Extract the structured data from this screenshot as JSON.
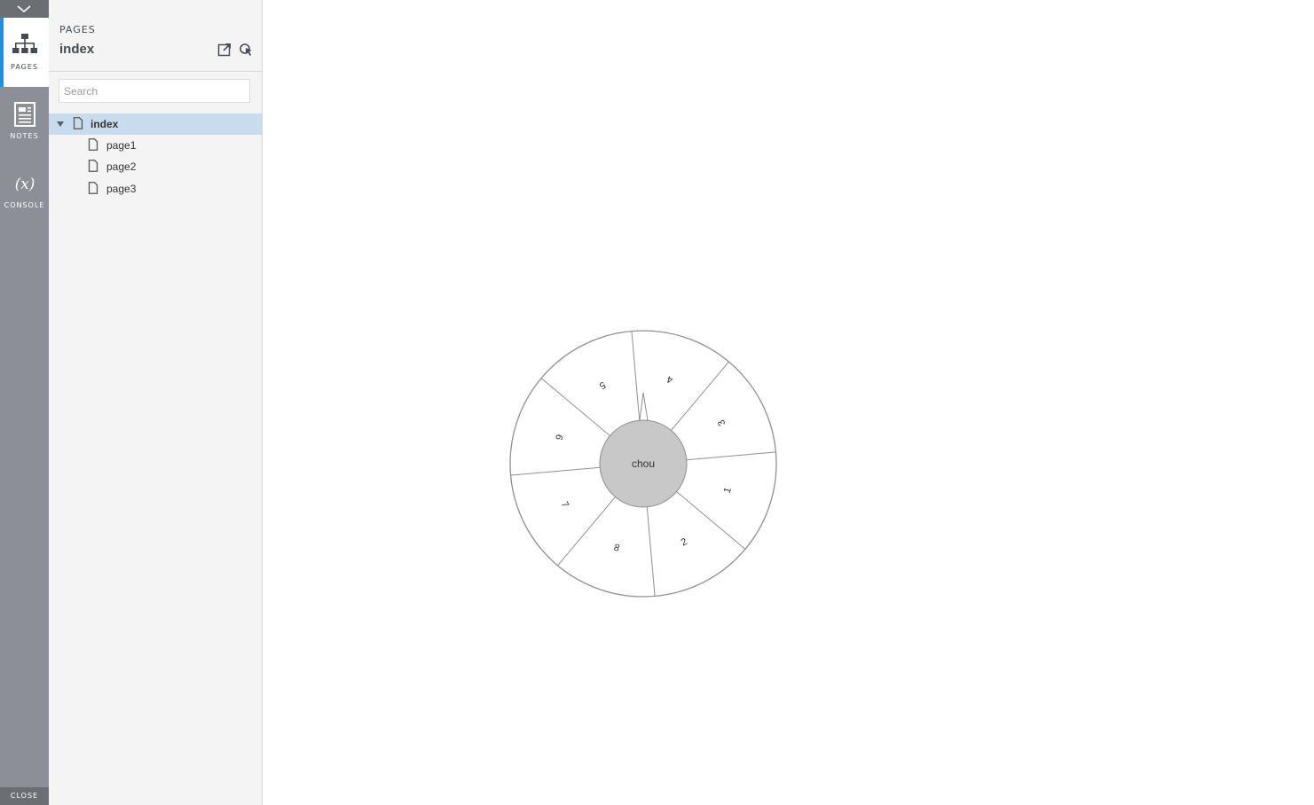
{
  "rail": {
    "tabs": [
      {
        "label": "PAGES",
        "icon": "sitemap-icon",
        "active": true
      },
      {
        "label": "NOTES",
        "icon": "notes-icon",
        "active": false
      },
      {
        "label": "CONSOLE",
        "icon": "variable-icon",
        "active": false
      }
    ],
    "close_label": "CLOSE"
  },
  "panel": {
    "heading": "PAGES",
    "current_page": "index",
    "search_placeholder": "Search",
    "tree": [
      {
        "label": "index",
        "level": 0,
        "expanded": true,
        "selected": true
      },
      {
        "label": "page1",
        "level": 1
      },
      {
        "label": "page2",
        "level": 1
      },
      {
        "label": "page3",
        "level": 1
      }
    ]
  },
  "wheel": {
    "center_label": "chou",
    "segments": [
      "1",
      "2",
      "8",
      "7",
      "6",
      "5",
      "4",
      "3"
    ],
    "colors": {
      "fill": "#ffffff",
      "stroke": "#8f8f8f",
      "hub": "#c8c8c8",
      "accent": "#1e8fe1"
    }
  }
}
